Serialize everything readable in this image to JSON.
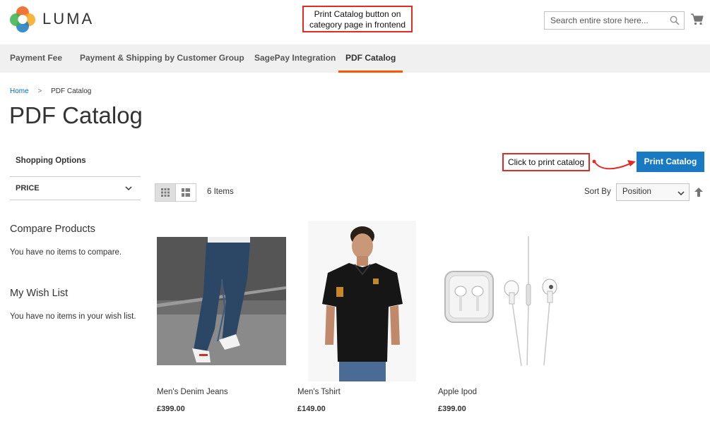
{
  "header": {
    "logo_text": "LUMA",
    "search_placeholder": "Search entire store here...",
    "callout": "Print Catalog button on category page in frontend"
  },
  "nav": {
    "items": [
      {
        "label": "Payment Fee"
      },
      {
        "label": "Payment & Shipping by Customer Group"
      },
      {
        "label": "SagePay Integration"
      },
      {
        "label": "PDF Catalog"
      }
    ],
    "active": "PDF Catalog"
  },
  "breadcrumb": {
    "home": "Home",
    "current": "PDF Catalog",
    "separator": ">"
  },
  "page_title": "PDF Catalog",
  "sidebar": {
    "shopping_options": "Shopping Options",
    "price_filter": "PRICE",
    "compare_title": "Compare Products",
    "compare_text": "You have no items to compare.",
    "wishlist_title": "My Wish List",
    "wishlist_text": "You have no items in your wish list."
  },
  "toolbar": {
    "items_count": "6 Items",
    "sort_label": "Sort By",
    "sort_value": "Position",
    "print_button": "Print Catalog",
    "print_callout": "Click to print catalog"
  },
  "products": [
    {
      "name": "Men's Denim Jeans",
      "price": "£399.00"
    },
    {
      "name": "Men's Tshirt",
      "price": "£149.00"
    },
    {
      "name": "Apple Ipod",
      "price": "£399.00"
    }
  ],
  "colors": {
    "accent_orange": "#ff5501",
    "button_blue": "#1979c3",
    "callout_red": "#e02b27",
    "nav_bg": "#f0f0f0",
    "link_blue": "#006bb4"
  }
}
